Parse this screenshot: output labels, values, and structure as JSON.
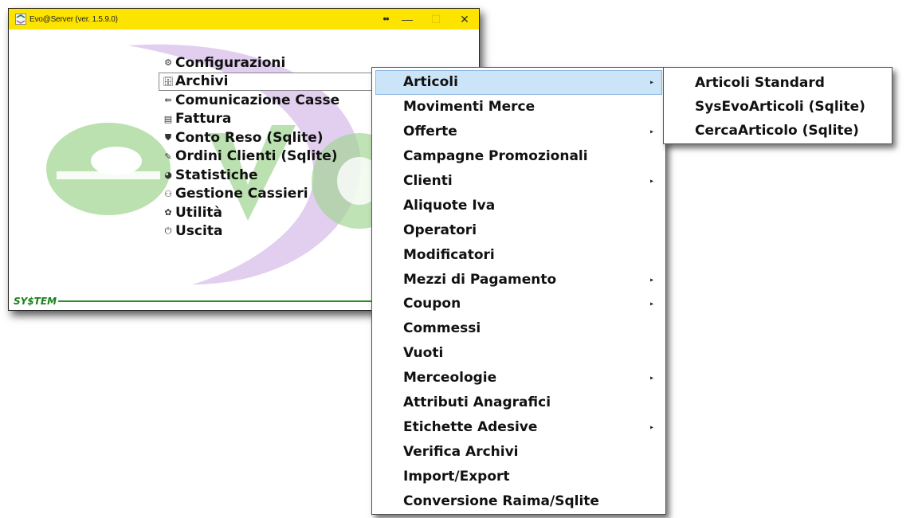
{
  "window": {
    "title": "Evo@Server (ver. 1.5.9.0)",
    "controls": {
      "extra": "••",
      "minimize": "—",
      "maximize": "☐",
      "close": "✕"
    }
  },
  "logo": {
    "footer_text": "SY$TEM"
  },
  "main_menu": {
    "items": [
      {
        "icon": "⚙",
        "label": "Configurazioni"
      },
      {
        "icon": "🗄",
        "label": "Archivi",
        "active": true
      },
      {
        "icon": "⇚",
        "label": "Comunicazione Casse"
      },
      {
        "icon": "▤",
        "label": "Fattura"
      },
      {
        "icon": "⛊",
        "label": "Conto Reso (Sqlite)"
      },
      {
        "icon": "✎",
        "label": "Ordini Clienti (Sqlite)"
      },
      {
        "icon": "◕",
        "label": "Statistiche"
      },
      {
        "icon": "⚇",
        "label": "Gestione Cassieri"
      },
      {
        "icon": "✿",
        "label": "Utilità"
      },
      {
        "icon": "⏻",
        "label": "Uscita"
      }
    ]
  },
  "archivi_menu": {
    "items": [
      {
        "label": "Articoli",
        "submenu": true,
        "highlighted": true
      },
      {
        "label": "Movimenti Merce",
        "submenu": false
      },
      {
        "label": "Offerte",
        "submenu": true
      },
      {
        "label": "Campagne Promozionali",
        "submenu": false
      },
      {
        "label": "Clienti",
        "submenu": true
      },
      {
        "label": "Aliquote Iva",
        "submenu": false
      },
      {
        "label": "Operatori",
        "submenu": false
      },
      {
        "label": "Modificatori",
        "submenu": false
      },
      {
        "label": "Mezzi di Pagamento",
        "submenu": true
      },
      {
        "label": "Coupon",
        "submenu": true
      },
      {
        "label": "Commessi",
        "submenu": false
      },
      {
        "label": "Vuoti",
        "submenu": false
      },
      {
        "label": "Merceologie",
        "submenu": true
      },
      {
        "label": "Attributi Anagrafici",
        "submenu": false
      },
      {
        "label": "Etichette Adesive",
        "submenu": true
      },
      {
        "label": "Verifica Archivi",
        "submenu": false
      },
      {
        "label": "Import/Export",
        "submenu": false
      },
      {
        "label": "Conversione Raima/Sqlite",
        "submenu": false
      }
    ],
    "arrow_glyph": "▸"
  },
  "articoli_menu": {
    "items": [
      {
        "label": "Articoli Standard"
      },
      {
        "label": "SysEvoArticoli (Sqlite)"
      },
      {
        "label": "CercaArticolo (Sqlite)"
      }
    ]
  },
  "colors": {
    "titlebar": "#fde300",
    "logo_green": "#3aa23a",
    "logo_purple": "#a56cc1",
    "menu_highlight": "#cce4f7"
  }
}
